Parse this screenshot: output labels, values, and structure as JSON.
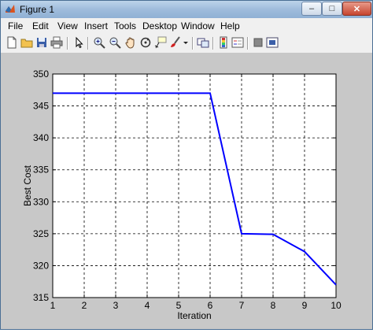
{
  "window": {
    "title": "Figure 1"
  },
  "menu": [
    "File",
    "Edit",
    "View",
    "Insert",
    "Tools",
    "Desktop",
    "Window",
    "Help"
  ],
  "toolbar": {
    "icons": [
      "new-figure-icon",
      "open-file-icon",
      "save-icon",
      "print-icon",
      "pointer-icon",
      "zoom-in-icon",
      "zoom-out-icon",
      "pan-hand-icon",
      "rotate-3d-icon",
      "data-cursor-icon",
      "brush-icon",
      "brush-dropdown-icon",
      "link-plot-icon",
      "colorbar-icon",
      "legend-icon",
      "hide-plot-tools-icon",
      "show-plot-tools-icon"
    ]
  },
  "chart_data": {
    "type": "line",
    "xlabel": "Iteration",
    "ylabel": "Best Cost",
    "xlim": [
      1,
      10
    ],
    "ylim": [
      315,
      350
    ],
    "x_ticks": [
      "1",
      "2",
      "3",
      "4",
      "5",
      "6",
      "7",
      "8",
      "9",
      "10"
    ],
    "y_ticks": [
      "315",
      "320",
      "325",
      "330",
      "335",
      "340",
      "345",
      "350"
    ],
    "grid": true,
    "line_color": "#0000ff",
    "series": [
      {
        "x": [
          1,
          2,
          3,
          4,
          5,
          6,
          7,
          8,
          9,
          10
        ],
        "values": [
          347,
          347,
          347,
          347,
          347,
          347,
          325,
          324.9,
          322.2,
          317
        ]
      }
    ]
  }
}
